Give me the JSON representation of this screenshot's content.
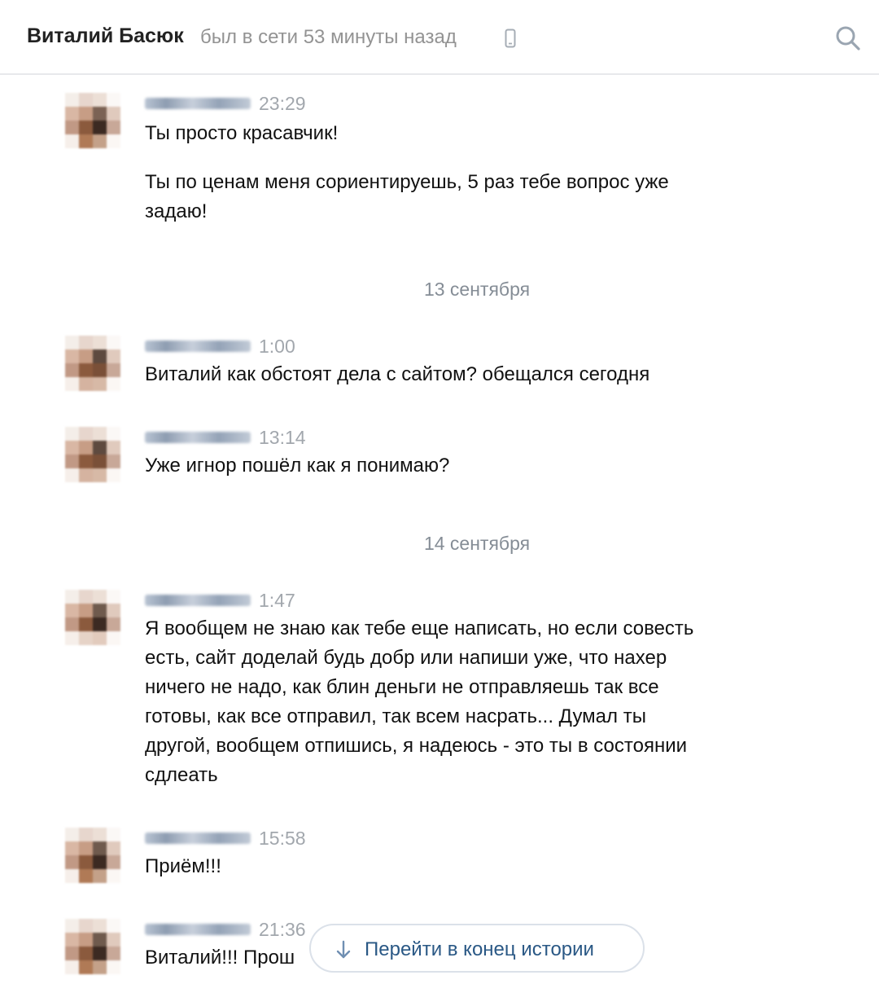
{
  "header": {
    "name": "Виталий Басюк",
    "status": "был в сети 53 минуты назад"
  },
  "messages": [
    {
      "time": "23:29",
      "text": "Ты просто красавчик!"
    },
    {
      "text": "Ты по ценам меня сориентируешь, 5 раз тебе вопрос уже\nзадаю!"
    },
    {
      "time": "1:00",
      "text": "Виталий как обстоят дела с сайтом? обещался сегодня"
    },
    {
      "time": "13:14",
      "text": "Уже игнор пошёл как я понимаю?"
    },
    {
      "time": "1:47",
      "text": "Я вообщем не знаю как тебе еще написать, но если совесть\nесть, сайт доделай будь добр или напиши уже, что нахер\nничего не надо, как блин деньги не отправляешь так все\nготовы, как все отправил, так всем насрать... Думал ты\nдругой, вообщем отпишись, я надеюсь - это ты в состоянии\nсдлеать"
    },
    {
      "time": "15:58",
      "text": "Приём!!!"
    },
    {
      "time": "21:36",
      "text": "Виталий!!! Прош"
    }
  ],
  "date_separators": [
    "13 сентября",
    "14 сентября"
  ],
  "jump_button": {
    "label": "Перейти в конец истории"
  },
  "icons": {
    "phone": "mobile-phone-icon",
    "search": "search-icon",
    "arrow": "arrow-down-icon"
  },
  "colors": {
    "link": "#2a5885",
    "muted": "#939393",
    "divider": "#e7e8ec"
  }
}
